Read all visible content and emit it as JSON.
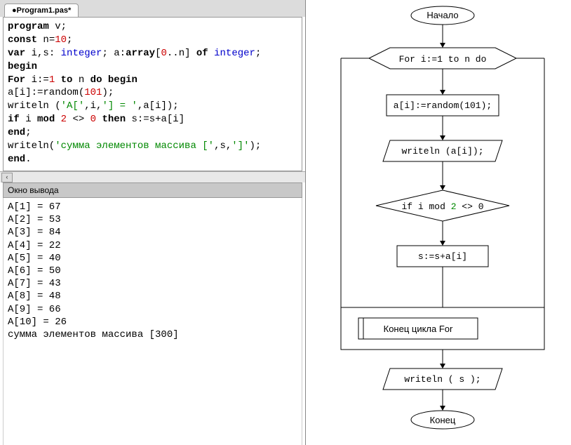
{
  "tab": {
    "title": "●Program1.pas*"
  },
  "code": {
    "tokens": [
      [
        {
          "t": "program",
          "c": "kw"
        },
        {
          "t": " v;"
        }
      ],
      [
        {
          "t": "const",
          "c": "kw"
        },
        {
          "t": " n="
        },
        {
          "t": "10",
          "c": "num"
        },
        {
          "t": ";"
        }
      ],
      [
        {
          "t": "var",
          "c": "kw"
        },
        {
          "t": " i,s: "
        },
        {
          "t": "integer",
          "c": "type"
        },
        {
          "t": "; a:"
        },
        {
          "t": "array",
          "c": "kw"
        },
        {
          "t": "["
        },
        {
          "t": "0",
          "c": "num"
        },
        {
          "t": "..n] "
        },
        {
          "t": "of",
          "c": "kw"
        },
        {
          "t": " "
        },
        {
          "t": "integer",
          "c": "type"
        },
        {
          "t": ";"
        }
      ],
      [
        {
          "t": "begin",
          "c": "kw"
        }
      ],
      [
        {
          "t": "For",
          "c": "kw"
        },
        {
          "t": " i:="
        },
        {
          "t": "1",
          "c": "num"
        },
        {
          "t": " "
        },
        {
          "t": "to",
          "c": "kw"
        },
        {
          "t": " n "
        },
        {
          "t": "do",
          "c": "kw"
        },
        {
          "t": " "
        },
        {
          "t": "begin",
          "c": "kw"
        }
      ],
      [
        {
          "t": "a[i]:=random("
        },
        {
          "t": "101",
          "c": "num"
        },
        {
          "t": ");"
        }
      ],
      [
        {
          "t": "writeln ("
        },
        {
          "t": "'A['",
          "c": "str"
        },
        {
          "t": ",i,"
        },
        {
          "t": "'] = '",
          "c": "str"
        },
        {
          "t": ",a[i]);"
        }
      ],
      [
        {
          "t": "if",
          "c": "kw"
        },
        {
          "t": " i "
        },
        {
          "t": "mod",
          "c": "kw"
        },
        {
          "t": " "
        },
        {
          "t": "2",
          "c": "num"
        },
        {
          "t": " <> "
        },
        {
          "t": "0",
          "c": "num"
        },
        {
          "t": " "
        },
        {
          "t": "then",
          "c": "kw"
        },
        {
          "t": " s:=s+a[i]"
        }
      ],
      [
        {
          "t": "end",
          "c": "kw"
        },
        {
          "t": ";"
        }
      ],
      [
        {
          "t": "writeln("
        },
        {
          "t": "'сумма элементов массива ['",
          "c": "str"
        },
        {
          "t": ",s,"
        },
        {
          "t": "']'",
          "c": "str"
        },
        {
          "t": ");"
        }
      ],
      [
        {
          "t": "end",
          "c": "kw"
        },
        {
          "t": "."
        }
      ]
    ]
  },
  "output_header": "Окно вывода",
  "output_lines": [
    "A[1] = 67",
    "A[2] = 53",
    "A[3] = 84",
    "A[4] = 22",
    "A[5] = 40",
    "A[6] = 50",
    "A[7] = 43",
    "A[8] = 48",
    "A[9] = 66",
    "A[10] = 26",
    "сумма элементов массива [300]"
  ],
  "flow": {
    "begin": "Начало",
    "for": "For i:=1 to n do",
    "assign": "a[i]:=random(101);",
    "write1": "writeln (a[i]);",
    "cond_pre": "if i mod ",
    "cond_num": "2",
    "cond_post": " <> 0",
    "sum": "s:=s+a[i]",
    "endfor": "Конец цикла For",
    "write2": "writeln ( s );",
    "end": "Конец"
  },
  "scroll_left_glyph": "‹"
}
